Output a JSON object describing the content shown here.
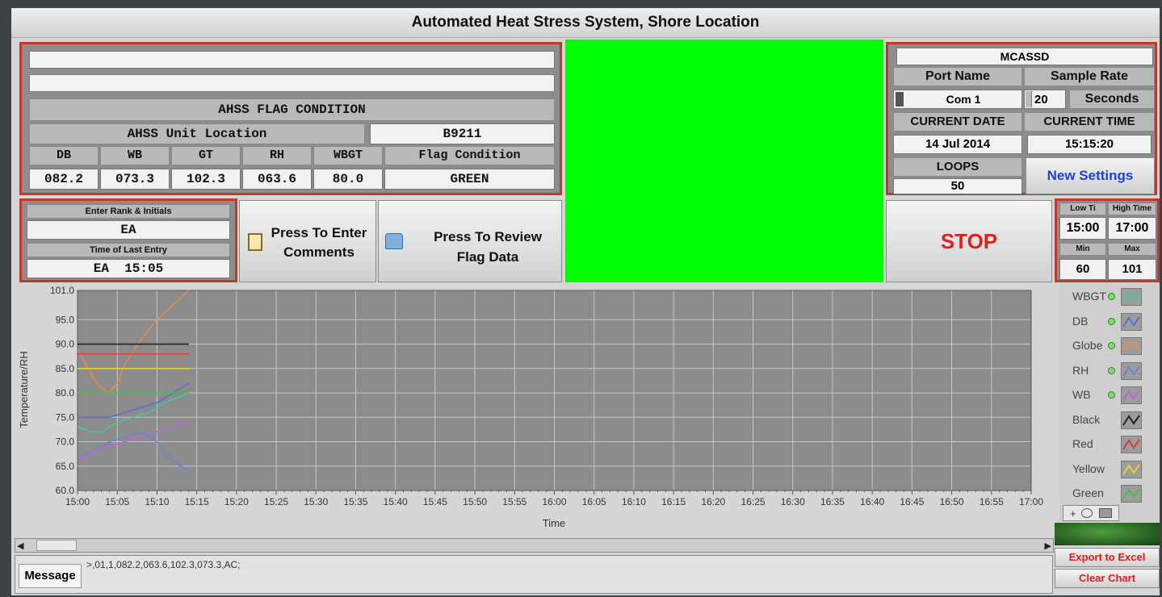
{
  "window": {
    "title": "Automated Heat Stress System, Shore Location"
  },
  "flag_panel": {
    "blank_1": "",
    "blank_2": "",
    "title": "AHSS FLAG CONDITION",
    "location_label": "AHSS Unit Location",
    "location_value": "B9211",
    "headers": [
      "DB",
      "WB",
      "GT",
      "RH",
      "WBGT",
      "Flag Condition"
    ],
    "values": [
      "082.2",
      "073.3",
      "102.3",
      "063.6",
      "80.0",
      "GREEN"
    ]
  },
  "entry_panel": {
    "rank_label": "Enter Rank & Initials",
    "rank_value": "EA",
    "time_label": "Time of Last Entry",
    "time_value": "EA  15:05"
  },
  "buttons": {
    "enter_comments": "Press To Enter Comments",
    "review_flag": "Press To Review Flag Data",
    "stop": "STOP",
    "new_settings": "New Settings",
    "export": "Export to Excel",
    "clear": "Clear Chart"
  },
  "settings": {
    "org": "MCASSD",
    "port_label": "Port Name",
    "port_value": "Com 1",
    "rate_label": "Sample Rate",
    "rate_value": "20",
    "rate_unit": "Seconds",
    "date_label": "CURRENT DATE",
    "date_value": "14 Jul 2014",
    "time_label": "CURRENT TIME",
    "time_value": "15:15:20",
    "loops_label": "LOOPS",
    "loops_value": "50"
  },
  "limits": {
    "low_label": "Low Ti",
    "high_label": "High Time",
    "low_value": "15:00",
    "high_value": "17:00",
    "min_label": "Min",
    "max_label": "Max",
    "min_value": "60",
    "max_value": "101"
  },
  "flag_color": "#00ff00",
  "chart_data": {
    "type": "line",
    "xlabel": "Time",
    "ylabel": "Temperature/RH",
    "ylim": [
      60,
      101
    ],
    "y_ticks": [
      "101.0",
      "95.0",
      "90.0",
      "85.0",
      "80.0",
      "75.0",
      "70.0",
      "65.0",
      "60.0"
    ],
    "y_tick_values": [
      101,
      95,
      90,
      85,
      80,
      75,
      70,
      65,
      60
    ],
    "x_ticks": [
      "15:00",
      "15:05",
      "15:10",
      "15:15",
      "15:20",
      "15:25",
      "15:30",
      "15:35",
      "15:40",
      "15:45",
      "15:50",
      "15:55",
      "16:00",
      "16:05",
      "16:10",
      "16:15",
      "16:20",
      "16:25",
      "16:30",
      "16:35",
      "16:40",
      "16:45",
      "16:50",
      "16:55",
      "17:00"
    ],
    "xlim_minutes": [
      0,
      120
    ],
    "grid": true,
    "background": "#8c8c8c",
    "series": [
      {
        "name": "WBGT",
        "color": "#46c6a6",
        "x": [
          0,
          2,
          3,
          5,
          7,
          9,
          11,
          14
        ],
        "y": [
          73,
          72,
          72,
          74,
          75,
          76,
          78,
          80
        ]
      },
      {
        "name": "DB",
        "color": "#5c6fd1",
        "x": [
          0,
          2,
          4,
          6,
          8,
          10,
          12,
          14
        ],
        "y": [
          75,
          75,
          75,
          76,
          77,
          78,
          80,
          82
        ]
      },
      {
        "name": "Globe",
        "color": "#e58a4c",
        "x": [
          0,
          1,
          2,
          3,
          4,
          5,
          6,
          8,
          10,
          12,
          14
        ],
        "y": [
          89,
          86,
          83,
          81,
          80,
          82,
          86,
          91,
          95,
          98,
          101
        ]
      },
      {
        "name": "RH",
        "color": "#6b83d6",
        "x": [
          0,
          2,
          4,
          6,
          8,
          10,
          12,
          14
        ],
        "y": [
          67,
          68,
          70,
          71,
          72,
          70,
          66,
          64
        ]
      },
      {
        "name": "WB",
        "color": "#b26ad8",
        "x": [
          0,
          2,
          4,
          6,
          8,
          10,
          12,
          14
        ],
        "y": [
          66,
          68,
          69,
          70,
          71,
          72,
          73,
          74
        ]
      },
      {
        "name": "Black",
        "color": "#222222",
        "x": [
          0,
          14
        ],
        "y": [
          90,
          90
        ]
      },
      {
        "name": "Red",
        "color": "#e03a3a",
        "x": [
          0,
          14
        ],
        "y": [
          88,
          88
        ]
      },
      {
        "name": "Yellow",
        "color": "#e8d23a",
        "x": [
          0,
          14
        ],
        "y": [
          85,
          85
        ]
      },
      {
        "name": "Green",
        "color": "#48c04a",
        "x": [
          0,
          14
        ],
        "y": [
          80,
          80
        ]
      }
    ]
  },
  "message": {
    "label": "Message",
    "text": ">,01,1,082.2,063.6,102.3,073.3,AC;"
  }
}
